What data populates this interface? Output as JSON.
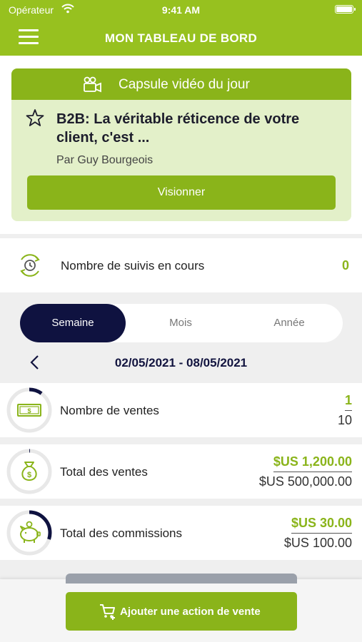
{
  "status_bar": {
    "carrier": "Opérateur",
    "time": "9:41 AM"
  },
  "header": {
    "title": "MON TABLEAU DE BORD"
  },
  "video_capsule": {
    "title": "Capsule vidéo du jour",
    "video_title": "B2B: La véritable réticence de votre client, c'est ...",
    "author": "Par Guy Bourgeois",
    "watch_label": "Visionner"
  },
  "followups": {
    "label": "Nombre de suivis en cours",
    "count": "0"
  },
  "period_tabs": [
    {
      "label": "Semaine",
      "active": true
    },
    {
      "label": "Mois",
      "active": false
    },
    {
      "label": "Année",
      "active": false
    }
  ],
  "date_range": "02/05/2021 - 08/05/2021",
  "metrics": [
    {
      "label": "Nombre de ventes",
      "value": "1",
      "target": "10",
      "progress": 0.1,
      "icon": "cash-icon"
    },
    {
      "label": "Total des ventes",
      "value": "$US 1,200.00",
      "target": "$US 500,000.00",
      "progress": 0.0024,
      "icon": "money-bag-icon"
    },
    {
      "label": "Total des commissions",
      "value": "$US 30.00",
      "target": "$US 100.00",
      "progress": 0.3,
      "icon": "piggy-bank-icon"
    }
  ],
  "add_sale_label": "Ajouter une action de vente",
  "colors": {
    "brand_green": "#97c11f",
    "button_green": "#8ab41a",
    "navy": "#0f1240",
    "card_bg": "#e3f0c9"
  }
}
